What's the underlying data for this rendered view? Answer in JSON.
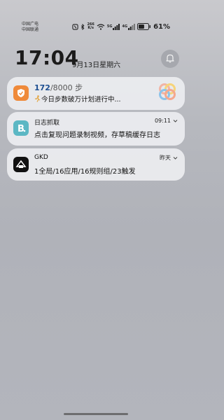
{
  "status_bar": {
    "carrier_1": "中国广电",
    "carrier_2": "中国联通",
    "net_speed_value": "266",
    "net_speed_unit": "K/s",
    "signal_1_label": "5G",
    "signal_2_label": "4G",
    "battery": "61%",
    "battery_level": 0.61
  },
  "lock": {
    "time": "17:04",
    "date": "9月13日星期六"
  },
  "notifications": [
    {
      "app": "steps",
      "title_value": "172",
      "title_goal": "/8000 步",
      "body": "今日步数破万计划进行中...",
      "accent": "#ef8a3a"
    },
    {
      "app": "日志抓取",
      "time": "09:11",
      "body": "点击复现问题录制视频，存草稿缓存日志",
      "accent": "#5bb7c4"
    },
    {
      "app": "GKD",
      "time": "昨天",
      "body": "1全局/16应用/16规则组/23触发",
      "accent": "#111111"
    }
  ]
}
